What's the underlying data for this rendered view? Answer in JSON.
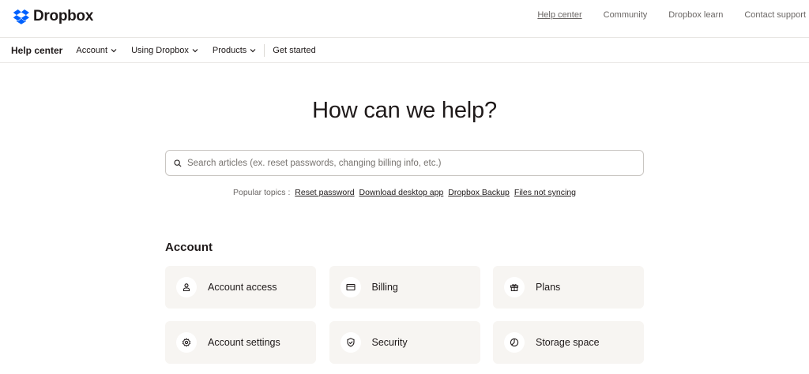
{
  "header": {
    "logo_text": "Dropbox",
    "brand_color": "#0061FE",
    "links": [
      {
        "label": "Help center"
      },
      {
        "label": "Community"
      },
      {
        "label": "Dropbox learn"
      },
      {
        "label": "Contact support"
      }
    ]
  },
  "subnav": {
    "brand": "Help center",
    "items": [
      {
        "label": "Account",
        "icon": "chevron-down-icon"
      },
      {
        "label": "Using Dropbox",
        "icon": "chevron-down-icon"
      },
      {
        "label": "Products",
        "icon": "chevron-down-icon"
      },
      {
        "label": "Get started"
      }
    ]
  },
  "hero": {
    "title": "How can we help?",
    "search_placeholder": "Search articles (ex. reset passwords, changing billing info, etc.)",
    "search_value": ""
  },
  "popular": {
    "label": "Popular topics :",
    "topics": [
      "Reset password",
      "Download desktop app",
      "Dropbox Backup",
      "Files not syncing"
    ]
  },
  "account_section": {
    "title": "Account",
    "cards": [
      {
        "label": "Account access",
        "icon": "person-icon"
      },
      {
        "label": "Billing",
        "icon": "credit-card-icon"
      },
      {
        "label": "Plans",
        "icon": "gift-icon"
      },
      {
        "label": "Account settings",
        "icon": "gear-icon"
      },
      {
        "label": "Security",
        "icon": "shield-check-icon"
      },
      {
        "label": "Storage space",
        "icon": "pie-chart-icon"
      }
    ]
  }
}
